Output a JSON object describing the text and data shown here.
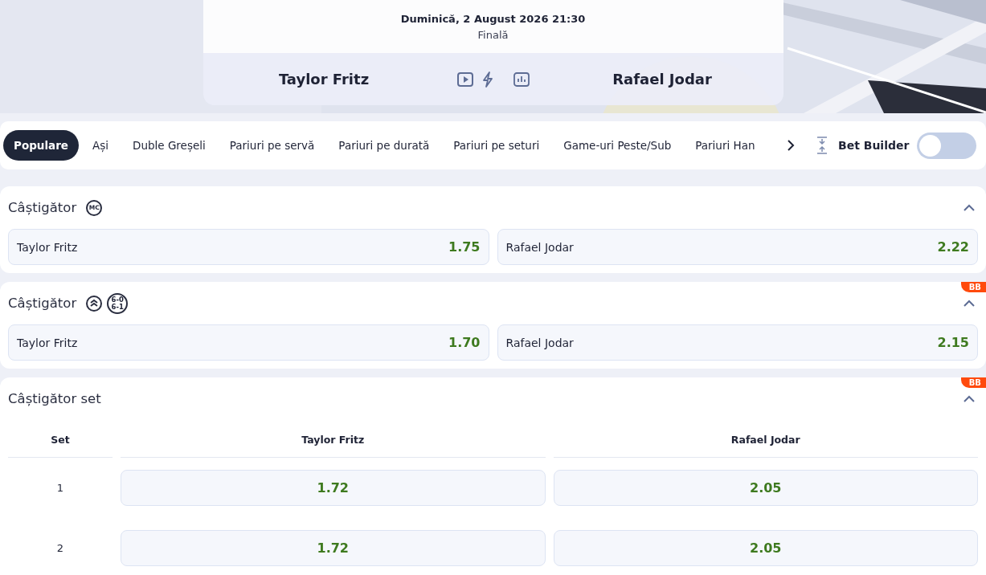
{
  "event": {
    "datetime": "Duminică, 2 August 2026 21:30",
    "stage": "Finală",
    "home": "Taylor Fritz",
    "away": "Rafael Jodar"
  },
  "tabs": [
    {
      "label": "Populare",
      "selected": true
    },
    {
      "label": "Ași",
      "selected": false
    },
    {
      "label": "Duble Greșeli",
      "selected": false
    },
    {
      "label": "Pariuri pe servă",
      "selected": false
    },
    {
      "label": "Pariuri pe durată",
      "selected": false
    },
    {
      "label": "Pariuri pe seturi",
      "selected": false
    },
    {
      "label": "Game-uri Peste/Sub",
      "selected": false
    },
    {
      "label": "Pariuri Han",
      "selected": false
    }
  ],
  "bet_builder": {
    "label": "Bet Builder",
    "on": false
  },
  "markets": [
    {
      "title": "Câștigător",
      "badges": [
        {
          "kind": "text",
          "text": "MC"
        }
      ],
      "expanded": true,
      "kind": "pair",
      "outcomes": [
        {
          "name": "Taylor Fritz",
          "odds": "1.75"
        },
        {
          "name": "Rafael Jodar",
          "odds": "2.22"
        }
      ]
    },
    {
      "title": "Câștigător",
      "badges": [
        {
          "kind": "chevrons"
        },
        {
          "kind": "score",
          "text": "6-0",
          "text2": "6-1"
        }
      ],
      "bb": "BB",
      "expanded": true,
      "kind": "pair",
      "outcomes": [
        {
          "name": "Taylor Fritz",
          "odds": "1.70"
        },
        {
          "name": "Rafael Jodar",
          "odds": "2.15"
        }
      ]
    },
    {
      "title": "Câștigător set",
      "bb": "BB",
      "expanded": true,
      "kind": "table",
      "columns": [
        "Set",
        "Taylor Fritz",
        "Rafael Jodar"
      ],
      "rows": [
        {
          "label": "1",
          "odds": [
            "1.72",
            "2.05"
          ]
        },
        {
          "label": "2",
          "odds": [
            "1.72",
            "2.05"
          ]
        }
      ]
    }
  ]
}
